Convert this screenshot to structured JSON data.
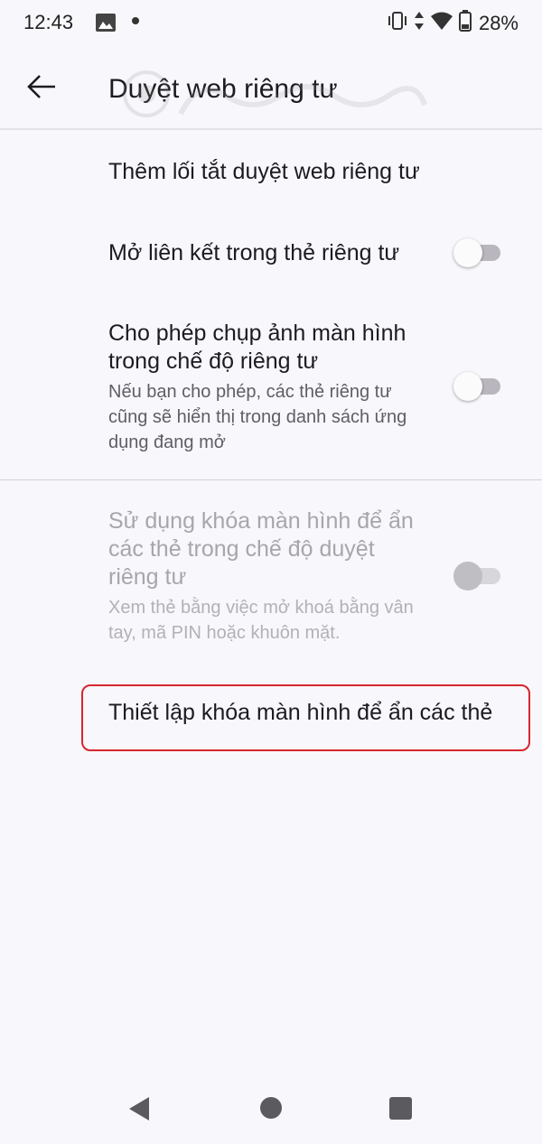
{
  "status_bar": {
    "time": "12:43",
    "battery": "28%",
    "icons": [
      "image-icon",
      "notification-dot-icon",
      "vibrate-icon",
      "data-arrows-icon",
      "wifi-icon",
      "battery-icon"
    ]
  },
  "app_bar": {
    "title": "Duyệt web riêng tư",
    "back_icon": "arrow-back-icon"
  },
  "settings": {
    "add_shortcut": {
      "title": "Thêm lối tắt duyệt web riêng tư"
    },
    "open_links": {
      "title": "Mở liên kết trong thẻ riêng tư",
      "enabled": false
    },
    "allow_screenshots": {
      "title": "Cho phép chụp ảnh màn hình trong chế độ riêng tư",
      "summary": "Nếu bạn cho phép, các thẻ riêng tư cũng sẽ hiển thị trong danh sách ứng dụng đang mở",
      "enabled": false
    },
    "use_screen_lock": {
      "title": "Sử dụng khóa màn hình để ẩn các thẻ trong chế độ duyệt riêng tư",
      "summary": "Xem thẻ bằng việc mở khoá bằng vân tay, mã PIN hoặc khuôn mặt.",
      "enabled": false,
      "disabled": true
    },
    "set_screen_lock": {
      "title": "Thiết lập khóa màn hình để ẩn các thẻ"
    }
  },
  "colors": {
    "background": "#f8f7fb",
    "highlight": "#d7262f"
  },
  "nav_bar": {
    "icons": [
      "nav-back-icon",
      "nav-home-icon",
      "nav-recents-icon"
    ]
  }
}
